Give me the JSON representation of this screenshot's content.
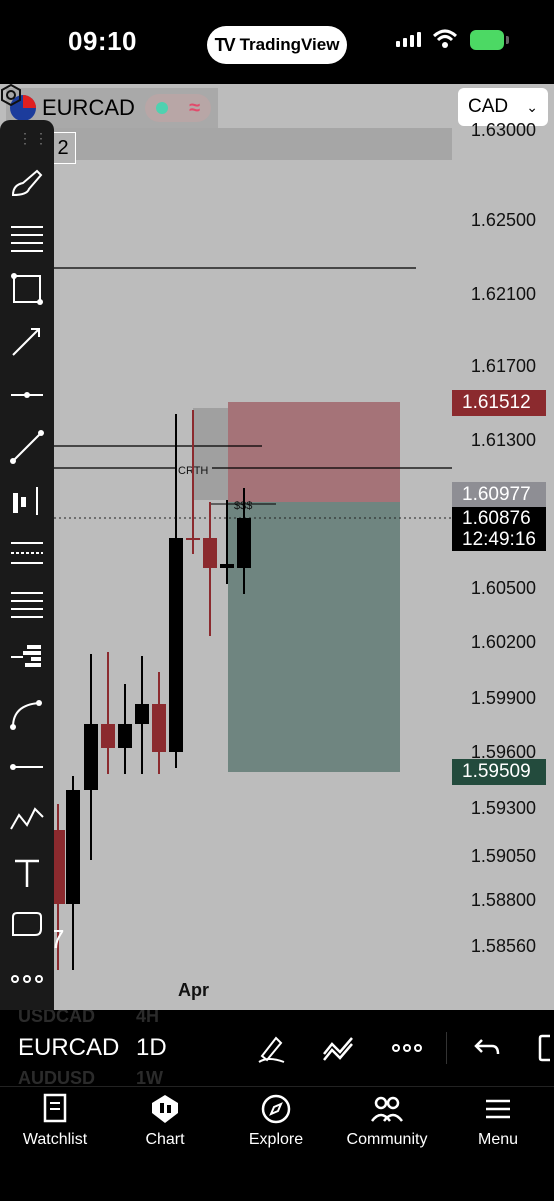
{
  "status": {
    "time": "09:10",
    "app_pill": "TradingView"
  },
  "chart": {
    "symbol": "EURCAD",
    "currency": "CAD",
    "interval_box": "2",
    "annotation_crth": "CRTH",
    "annotation_sss": "$$$",
    "left_edge_digit": "7",
    "date_label": "Apr",
    "price_axis": [
      "1.63000",
      "1.62500",
      "1.62100",
      "1.61700",
      "1.61300",
      "1.60500",
      "1.60200",
      "1.59900",
      "1.59600",
      "1.59300",
      "1.59050",
      "1.58800",
      "1.58560"
    ],
    "tags": {
      "stop_price": "1.61512",
      "entry_price": "1.60977",
      "current_price": "1.60876",
      "countdown": "12:49:16",
      "target_price": "1.59509"
    },
    "colors": {
      "background": "#bcbcbc",
      "bull_candle": "#000000",
      "bear_candle": "#8b2a2e",
      "stop_zone": "#a57378",
      "target_zone": "#6f8580"
    }
  },
  "toolbar": {
    "tools": [
      "brush-icon",
      "horizontal-lines-icon",
      "rectangle-icon",
      "arrow-line-icon",
      "horizontal-ray-icon",
      "trend-line-icon",
      "price-range-icon",
      "fib-channel-icon",
      "fib-levels-icon",
      "volume-profile-icon",
      "curve-icon",
      "horizontal-line-icon",
      "pattern-icon",
      "text-icon",
      "callout-icon",
      "more-icon"
    ]
  },
  "timeframe_bar": {
    "ghost_above": [
      "USDCAD",
      "4H"
    ],
    "symbol": "EURCAD",
    "interval": "1D",
    "ghost_below": [
      "AUDUSD",
      "1W"
    ]
  },
  "nav": {
    "items": [
      {
        "label": "Watchlist",
        "icon": "watchlist-icon"
      },
      {
        "label": "Chart",
        "icon": "chart-icon"
      },
      {
        "label": "Explore",
        "icon": "compass-icon"
      },
      {
        "label": "Community",
        "icon": "community-icon"
      },
      {
        "label": "Menu",
        "icon": "menu-icon"
      }
    ]
  }
}
